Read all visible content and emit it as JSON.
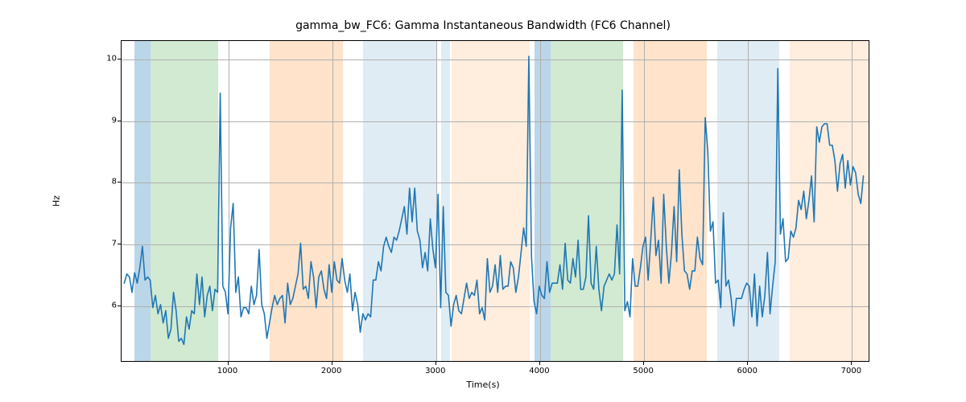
{
  "chart_data": {
    "type": "line",
    "title": "gamma_bw_FC6: Gamma Instantaneous Bandwidth (FC6 Channel)",
    "xlabel": "Time(s)",
    "ylabel": "Hz",
    "xlim": [
      -26,
      7175
    ],
    "ylim": [
      5.08,
      10.3
    ],
    "xticks": [
      1000,
      2000,
      3000,
      4000,
      5000,
      6000,
      7000
    ],
    "yticks": [
      6,
      7,
      8,
      9,
      10
    ],
    "line_color": "#1f77b4",
    "bands": [
      {
        "start": 100,
        "end": 250,
        "color": "rgba(31,119,180,0.30)"
      },
      {
        "start": 250,
        "end": 900,
        "color": "rgba(44,160,44,0.22)"
      },
      {
        "start": 1400,
        "end": 2100,
        "color": "rgba(255,127,14,0.22)"
      },
      {
        "start": 2300,
        "end": 3000,
        "color": "rgba(31,119,180,0.14)"
      },
      {
        "start": 3050,
        "end": 3130,
        "color": "rgba(31,119,180,0.14)"
      },
      {
        "start": 3150,
        "end": 3900,
        "color": "rgba(255,127,14,0.14)"
      },
      {
        "start": 3950,
        "end": 4100,
        "color": "rgba(31,119,180,0.30)"
      },
      {
        "start": 4100,
        "end": 4800,
        "color": "rgba(44,160,44,0.22)"
      },
      {
        "start": 4900,
        "end": 5600,
        "color": "rgba(255,127,14,0.22)"
      },
      {
        "start": 5700,
        "end": 6300,
        "color": "rgba(31,119,180,0.14)"
      },
      {
        "start": 6400,
        "end": 7149,
        "color": "rgba(255,127,14,0.14)"
      }
    ],
    "x": [
      0,
      25,
      50,
      75,
      100,
      125,
      150,
      175,
      200,
      225,
      250,
      275,
      300,
      325,
      350,
      375,
      400,
      425,
      450,
      475,
      500,
      525,
      550,
      575,
      600,
      625,
      650,
      675,
      700,
      725,
      750,
      775,
      800,
      825,
      850,
      875,
      900,
      925,
      950,
      975,
      1000,
      1025,
      1050,
      1075,
      1100,
      1125,
      1150,
      1175,
      1200,
      1225,
      1250,
      1275,
      1300,
      1325,
      1350,
      1375,
      1400,
      1425,
      1450,
      1475,
      1500,
      1525,
      1550,
      1575,
      1600,
      1625,
      1650,
      1675,
      1700,
      1725,
      1750,
      1775,
      1800,
      1825,
      1850,
      1875,
      1900,
      1925,
      1950,
      1975,
      2000,
      2025,
      2050,
      2075,
      2100,
      2125,
      2150,
      2175,
      2200,
      2225,
      2250,
      2275,
      2300,
      2325,
      2350,
      2375,
      2400,
      2425,
      2450,
      2475,
      2500,
      2525,
      2550,
      2575,
      2600,
      2625,
      2650,
      2675,
      2700,
      2725,
      2750,
      2775,
      2800,
      2825,
      2850,
      2875,
      2900,
      2925,
      2950,
      2975,
      3000,
      3025,
      3050,
      3075,
      3100,
      3125,
      3150,
      3175,
      3200,
      3225,
      3250,
      3275,
      3300,
      3325,
      3350,
      3375,
      3400,
      3425,
      3450,
      3475,
      3500,
      3525,
      3550,
      3575,
      3600,
      3625,
      3650,
      3675,
      3700,
      3725,
      3750,
      3775,
      3800,
      3825,
      3850,
      3875,
      3900,
      3925,
      3950,
      3975,
      4000,
      4025,
      4050,
      4075,
      4100,
      4125,
      4150,
      4175,
      4200,
      4225,
      4250,
      4275,
      4300,
      4325,
      4350,
      4375,
      4400,
      4425,
      4450,
      4475,
      4500,
      4525,
      4550,
      4575,
      4600,
      4625,
      4650,
      4675,
      4700,
      4725,
      4750,
      4775,
      4800,
      4825,
      4850,
      4875,
      4900,
      4925,
      4950,
      4975,
      5000,
      5025,
      5050,
      5075,
      5100,
      5125,
      5150,
      5175,
      5200,
      5225,
      5250,
      5275,
      5300,
      5325,
      5350,
      5375,
      5400,
      5425,
      5450,
      5475,
      5500,
      5525,
      5550,
      5575,
      5600,
      5625,
      5650,
      5675,
      5700,
      5725,
      5750,
      5775,
      5800,
      5825,
      5850,
      5875,
      5900,
      5925,
      5950,
      5975,
      6000,
      6025,
      6050,
      6075,
      6100,
      6125,
      6150,
      6175,
      6200,
      6225,
      6250,
      6275,
      6300,
      6325,
      6350,
      6375,
      6400,
      6425,
      6450,
      6475,
      6500,
      6525,
      6550,
      6575,
      6600,
      6625,
      6650,
      6675,
      6700,
      6725,
      6750,
      6775,
      6800,
      6825,
      6850,
      6875,
      6900,
      6925,
      6950,
      6975,
      7000,
      7025,
      7050,
      7075,
      7100,
      7125,
      7149
    ],
    "values": [
      6.35,
      6.5,
      6.45,
      6.2,
      6.52,
      6.35,
      6.6,
      6.95,
      6.4,
      6.45,
      6.4,
      5.95,
      6.15,
      5.85,
      6.0,
      5.7,
      5.9,
      5.45,
      5.6,
      6.2,
      5.9,
      5.4,
      5.45,
      5.35,
      5.8,
      5.6,
      5.9,
      5.85,
      6.5,
      6.0,
      6.45,
      5.8,
      6.15,
      6.3,
      5.9,
      6.25,
      6.2,
      9.45,
      6.3,
      6.2,
      5.85,
      7.25,
      7.65,
      6.2,
      6.45,
      5.8,
      5.95,
      5.95,
      5.85,
      6.3,
      6.0,
      6.15,
      6.9,
      6.0,
      5.85,
      5.45,
      5.7,
      5.95,
      6.15,
      6.0,
      6.1,
      6.15,
      5.7,
      6.35,
      6.0,
      6.1,
      6.3,
      6.5,
      7.0,
      6.25,
      6.3,
      6.1,
      6.7,
      6.45,
      5.95,
      6.45,
      6.55,
      6.25,
      6.1,
      6.65,
      6.2,
      6.7,
      6.4,
      6.35,
      6.75,
      6.4,
      6.2,
      6.5,
      5.9,
      6.2,
      6.0,
      5.55,
      5.85,
      5.75,
      5.85,
      5.8,
      6.4,
      6.4,
      6.7,
      6.55,
      6.95,
      7.1,
      6.95,
      6.85,
      7.1,
      7.05,
      7.2,
      7.4,
      7.6,
      7.15,
      7.9,
      7.35,
      7.9,
      7.2,
      7.05,
      6.6,
      6.85,
      6.55,
      7.4,
      6.9,
      6.6,
      7.8,
      5.95,
      7.6,
      6.2,
      6.15,
      5.65,
      6.0,
      6.15,
      5.9,
      5.85,
      6.1,
      6.35,
      6.1,
      6.2,
      6.15,
      6.4,
      5.85,
      5.95,
      5.75,
      6.75,
      6.2,
      6.3,
      6.65,
      6.2,
      6.8,
      6.25,
      6.3,
      6.3,
      6.7,
      6.6,
      6.2,
      6.45,
      6.85,
      7.25,
      6.95,
      10.05,
      6.8,
      6.05,
      5.85,
      6.3,
      6.15,
      6.1,
      6.7,
      6.2,
      6.35,
      6.35,
      6.35,
      6.65,
      6.25,
      7.0,
      6.4,
      6.35,
      6.75,
      6.45,
      7.05,
      6.25,
      6.25,
      6.45,
      7.45,
      6.35,
      6.25,
      6.95,
      6.25,
      5.9,
      6.3,
      6.4,
      6.5,
      6.4,
      6.5,
      7.3,
      6.5,
      9.5,
      5.9,
      6.05,
      5.8,
      6.75,
      6.3,
      6.3,
      6.6,
      6.95,
      7.1,
      6.4,
      7.05,
      7.75,
      6.8,
      7.05,
      6.35,
      7.8,
      6.95,
      6.35,
      6.85,
      7.6,
      6.7,
      8.2,
      7.15,
      6.55,
      6.5,
      6.25,
      6.55,
      6.55,
      7.1,
      6.75,
      6.65,
      9.05,
      8.5,
      7.2,
      7.35,
      6.35,
      6.4,
      5.95,
      7.5,
      6.3,
      6.4,
      6.1,
      5.65,
      6.1,
      6.1,
      6.1,
      6.25,
      6.35,
      6.3,
      5.8,
      6.5,
      5.65,
      6.3,
      5.8,
      6.15,
      6.85,
      5.85,
      6.3,
      6.7,
      9.85,
      7.15,
      7.4,
      6.7,
      6.75,
      7.2,
      7.1,
      7.25,
      7.7,
      7.55,
      7.85,
      7.4,
      7.7,
      8.1,
      7.35,
      8.9,
      8.65,
      8.9,
      8.95,
      8.95,
      8.6,
      8.6,
      8.35,
      7.85,
      8.3,
      8.45,
      7.9,
      8.35,
      7.95,
      8.25,
      8.15,
      7.8,
      7.65,
      8.1
    ]
  }
}
